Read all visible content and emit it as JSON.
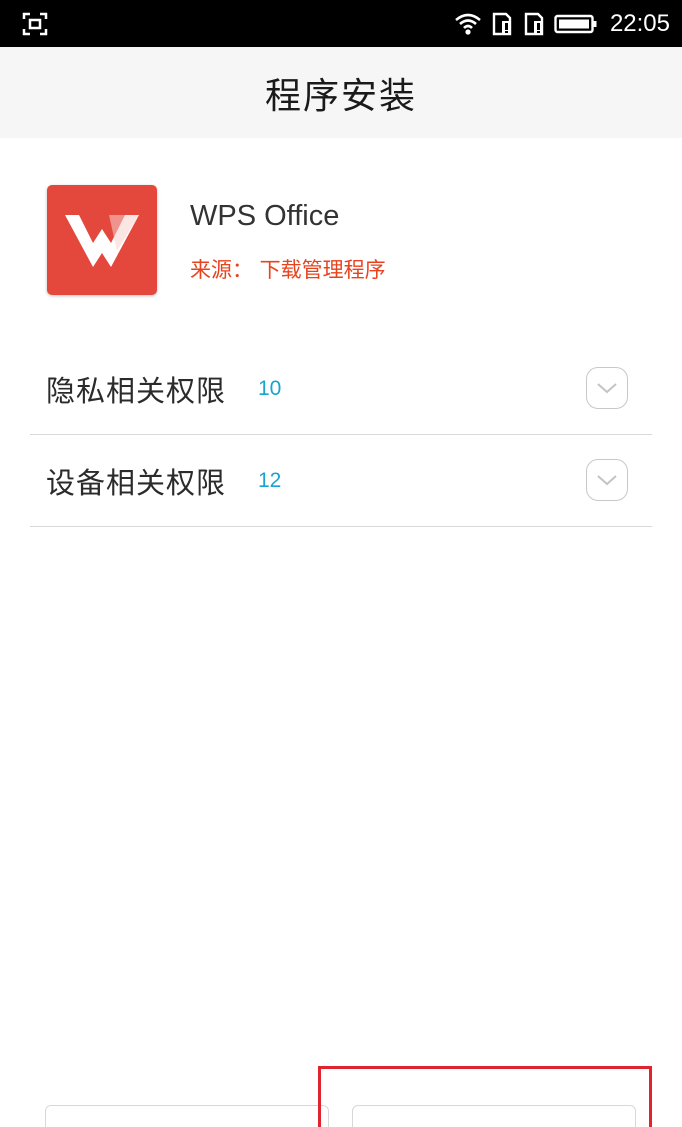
{
  "status_bar": {
    "time": "22:05",
    "icons": [
      "screenshot-icon",
      "wifi-icon",
      "sim1-icon",
      "sim2-icon",
      "battery-icon"
    ]
  },
  "header": {
    "title": "程序安装"
  },
  "app": {
    "name": "WPS Office",
    "source": "来源： 下载管理程序",
    "icon": "wps-office-icon",
    "icon_color": "#e4483d"
  },
  "permissions": [
    {
      "label": "隐私相关权限",
      "count": "10"
    },
    {
      "label": "设备相关权限",
      "count": "12"
    }
  ],
  "buttons": {
    "cancel_label": "",
    "install_label": ""
  },
  "colors": {
    "source_text": "#e8431f",
    "count_text": "#1aa3cf",
    "highlight": "#e0242f"
  }
}
